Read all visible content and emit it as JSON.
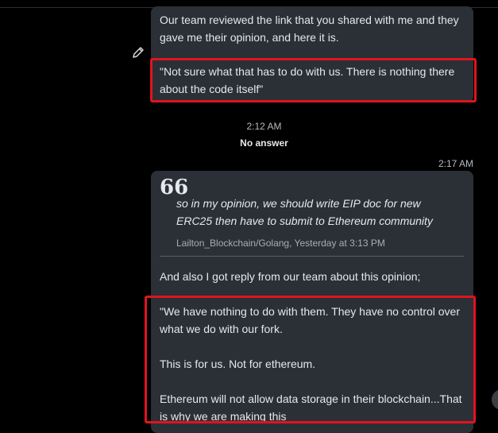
{
  "messages": {
    "first": {
      "para1": "Our team reviewed the link that you shared with me and they gave me their opinion, and here it is.",
      "para2": "\"Not sure what that has to do with us. There is nothing there about the code itself\""
    },
    "time_1": "2:12 AM",
    "system_note": "No answer",
    "time_2": "2:17 AM",
    "second": {
      "quote_text": "so in my opinion, we should write EIP doc for new ERC25 then have to submit to Ethereum community",
      "quote_meta": "Lailton_Blockchain/Golang, Yesterday at 3:13 PM",
      "para1": "And also I got reply from our team about this opinion;",
      "para2": "\"We have nothing to do with them. They have no control over what we do with our fork.\n\nThis is for us. Not for ethereum.\n\nEthereum will not allow data storage in their blockchain...That is why we are making this"
    }
  },
  "icons": {
    "edit": "pencil-icon",
    "quote": "quote-mark-icon"
  },
  "colors": {
    "background": "#000000",
    "bubble": "#2b2f36",
    "highlight": "#e0141e"
  }
}
